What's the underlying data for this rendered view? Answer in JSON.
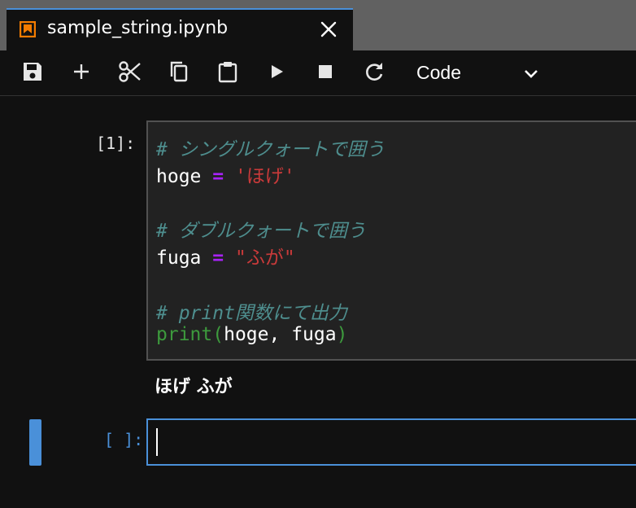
{
  "tab": {
    "title": "sample_string.ipynb",
    "icon": "notebook-icon",
    "accent_color": "#f57c00"
  },
  "toolbar": {
    "buttons": [
      "save-icon",
      "add-icon",
      "cut-icon",
      "copy-icon",
      "paste-icon",
      "run-icon",
      "stop-icon",
      "restart-icon"
    ],
    "cell_type": "Code"
  },
  "cells": [
    {
      "prompt": "[1]:",
      "code": {
        "line1": "# シングルクォートで囲う",
        "line2_name": "hoge",
        "line2_op": "=",
        "line2_str": "'ほげ'",
        "line4": "# ダブルクォートで囲う",
        "line5_name": "fuga",
        "line5_op": "=",
        "line5_str": "\"ふが\"",
        "line7": "# print関数にて出力",
        "line8_func": "print",
        "line8_open": "(",
        "line8_args": "hoge, fuga",
        "line8_close": ")"
      },
      "output": "ほげ ふが"
    },
    {
      "prompt": "[ ]:",
      "code": ""
    }
  ],
  "colors": {
    "active_cell": "#4a90d9",
    "comment": "#4e8e8e",
    "string": "#c93a3a",
    "operator": "#aa22ff",
    "builtin": "#3d9a3d"
  }
}
